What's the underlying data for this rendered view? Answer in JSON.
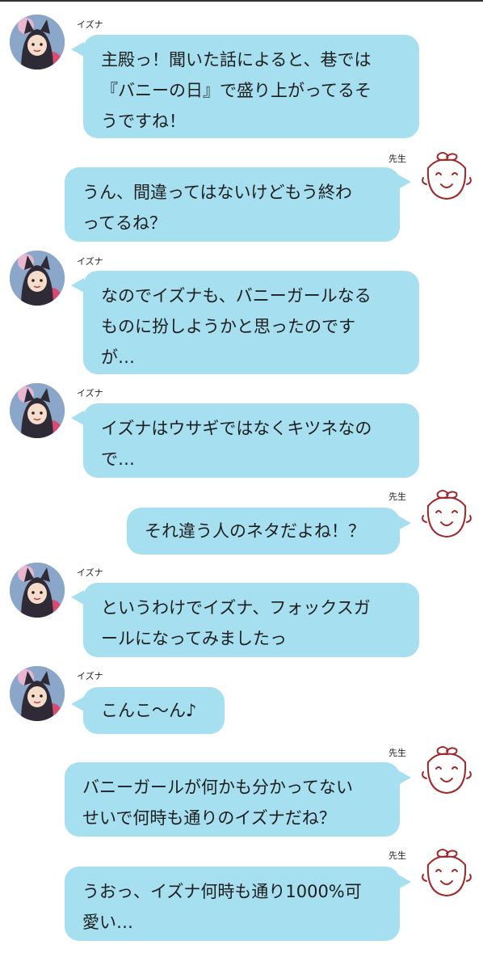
{
  "colors": {
    "bubble": "#a6dff0",
    "sensei_ink": "#a0282a"
  },
  "messages": [
    {
      "sender": "izuna",
      "name": "イズナ",
      "text": "主殿っ！聞いた話によると、巷では\n『バニーの日』で盛り上がってるそ\nうですね！"
    },
    {
      "sender": "sensei",
      "name": "先生",
      "text": "うん、間違ってはないけどもう終わ\nってるね？"
    },
    {
      "sender": "izuna",
      "name": "イズナ",
      "text": "なのでイズナも、バニーガールなる\nものに扮しようかと思ったのです\nが…"
    },
    {
      "sender": "izuna",
      "name": "イズナ",
      "text": "イズナはウサギではなくキツネなの\nで…"
    },
    {
      "sender": "sensei",
      "name": "先生",
      "text": "それ違う人のネタだよね！？"
    },
    {
      "sender": "izuna",
      "name": "イズナ",
      "text": "というわけでイズナ、フォックスガ\nールになってみましたっ"
    },
    {
      "sender": "izuna",
      "name": "イズナ",
      "text": "こんこ～ん♪"
    },
    {
      "sender": "sensei",
      "name": "先生",
      "text": "バニーガールが何かも分かってない\nせいで何時も通りのイズナだね？"
    },
    {
      "sender": "sensei",
      "name": "先生",
      "text": "うおっ、イズナ何時も通り1000%可\n愛い…"
    }
  ]
}
